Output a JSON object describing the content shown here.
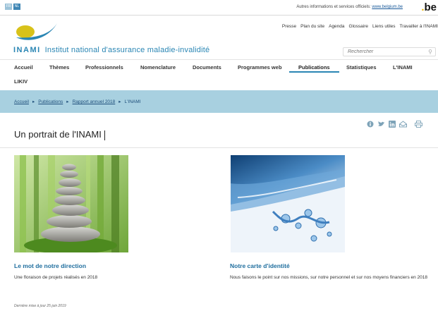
{
  "top_bar": {
    "languages": [
      "FR",
      "NL"
    ],
    "federal_text": "Autres informations et services officiels:",
    "federal_link": "www.belgium.be",
    "be_logo_letters": "be"
  },
  "header": {
    "abbr": "INAMI",
    "name": "Institut national d'assurance maladie-invalidité",
    "utility_nav": [
      "Presse",
      "Plan du site",
      "Agenda",
      "Glossaire",
      "Liens utiles",
      "Travailler à l'INAMI"
    ],
    "search_placeholder": "Rechercher"
  },
  "main_nav": [
    {
      "label": "Accueil",
      "active": false
    },
    {
      "label": "Thèmes",
      "active": false
    },
    {
      "label": "Professionnels",
      "active": false
    },
    {
      "label": "Nomenclature",
      "active": false
    },
    {
      "label": "Documents",
      "active": false
    },
    {
      "label": "Programmes web",
      "active": false
    },
    {
      "label": "Publications",
      "active": true
    },
    {
      "label": "Statistiques",
      "active": false
    },
    {
      "label": "L'INAMI",
      "active": false
    }
  ],
  "second_row": "LIKIV",
  "breadcrumb": {
    "links": [
      "Accueil",
      "Publications",
      "Rapport annuel 2018"
    ],
    "current": "L'INAMI"
  },
  "page_title": "Un portrait de l'INAMI",
  "share_icons": [
    "info-icon",
    "twitter-icon",
    "linkedin-icon",
    "email-icon",
    "print-icon"
  ],
  "cards": [
    {
      "title": "Le mot de notre direction",
      "description": "Une floraison de projets réalisés en 2018",
      "image": "stacked-stones-bamboo"
    },
    {
      "title": "Notre carte d'identité",
      "description": "Nous faisons le point sur nos missions, sur notre personnel et sur nos moyens financiers en 2018",
      "image": "water-splash"
    }
  ],
  "footer": {
    "last_update": "Dernière mise à jour 25 juin 2019"
  },
  "colors": {
    "brand_blue": "#2a86b4",
    "breadcrumb_band": "#a8d0e0",
    "logo_yellow": "#d8c21a",
    "logo_teal": "#2a86b4"
  }
}
